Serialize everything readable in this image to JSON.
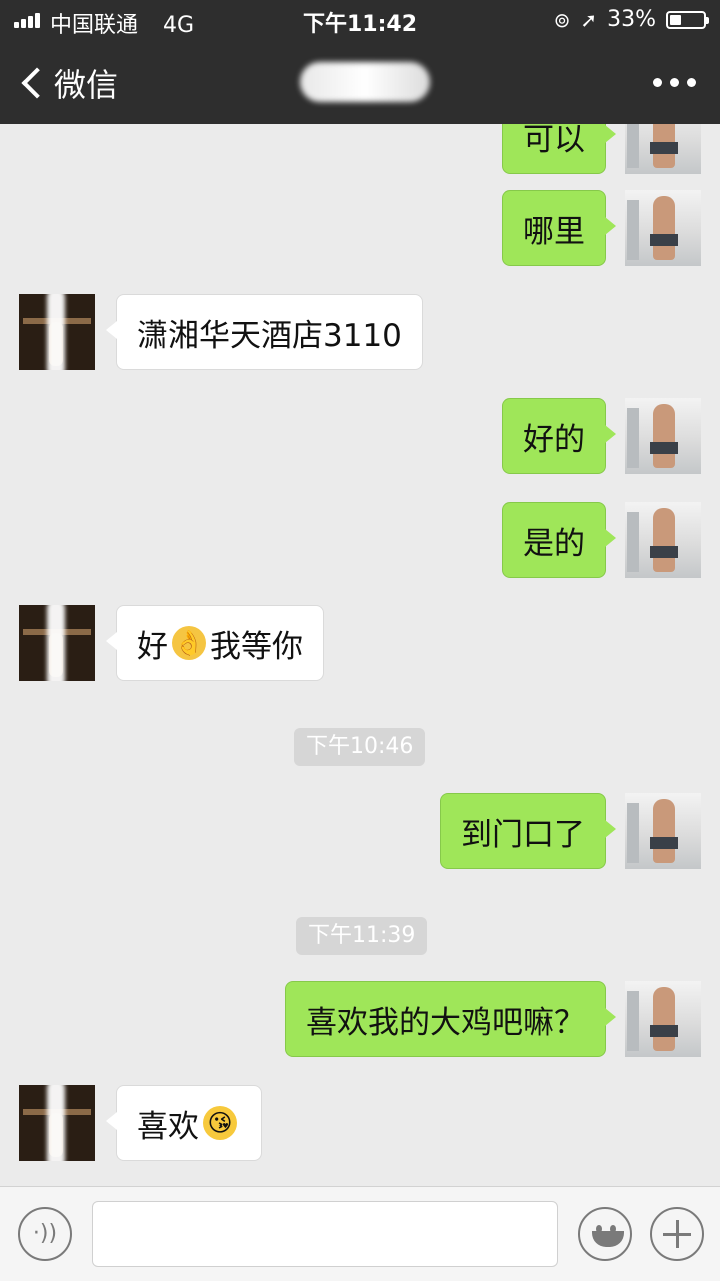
{
  "status_bar": {
    "carrier": "中国联通",
    "network": "4G",
    "time": "下午11:42",
    "battery": "33%",
    "battery_level": 0.33
  },
  "nav": {
    "back_label": "微信",
    "more_icon": "more-dots-icon"
  },
  "messages": [
    {
      "side": "self",
      "text": "可以"
    },
    {
      "side": "self",
      "text": "哪里"
    },
    {
      "side": "other",
      "text": "潇湘华天酒店3110"
    },
    {
      "side": "self",
      "text": "好的"
    },
    {
      "side": "self",
      "text": "是的"
    },
    {
      "side": "other",
      "text_a": "好",
      "emoji": "ok-hand-emoji",
      "text_b": "我等你"
    },
    {
      "type": "timestamp",
      "text": "下午10:46"
    },
    {
      "side": "self",
      "text": "到门口了"
    },
    {
      "type": "timestamp",
      "text": "下午11:39"
    },
    {
      "side": "self",
      "text": "喜欢我的大鸡吧嘛？"
    },
    {
      "side": "other",
      "text_a": "喜欢",
      "emoji": "kissing-face-emoji"
    }
  ],
  "input_bar": {
    "voice_icon": "voice-icon",
    "emoji_icon": "smiley-icon",
    "plus_icon": "plus-icon",
    "text_value": ""
  },
  "colors": {
    "nav_bg": "#2e2e2e",
    "chat_bg": "#ebebeb",
    "self_bubble": "#9fe659",
    "other_bubble": "#ffffff",
    "timestamp_bg": "#d6d6d6"
  }
}
